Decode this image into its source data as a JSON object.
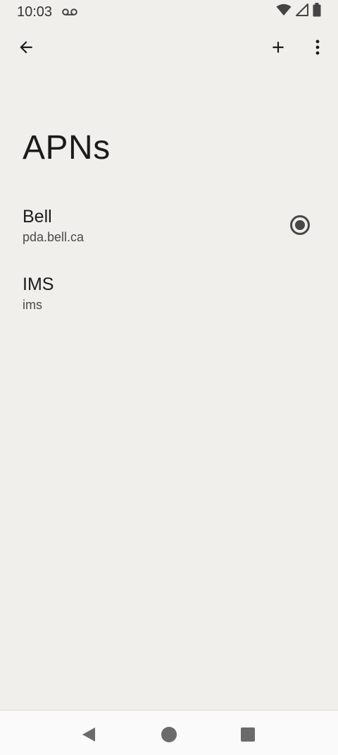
{
  "status_bar": {
    "time": "10:03",
    "icons": [
      "voicemail-icon",
      "wifi-icon",
      "signal-icon",
      "battery-icon"
    ]
  },
  "toolbar": {
    "back_icon": "arrow-back-icon",
    "add_icon": "plus-icon",
    "more_icon": "more-vert-icon"
  },
  "page": {
    "title": "APNs"
  },
  "apns": [
    {
      "name": "Bell",
      "address": "pda.bell.ca",
      "selected": true
    },
    {
      "name": "IMS",
      "address": "ims",
      "selected": false
    }
  ],
  "nav_bar": {
    "icons": [
      "nav-back-icon",
      "nav-home-icon",
      "nav-recents-icon"
    ]
  },
  "colors": {
    "background": "#f0efeb",
    "text_primary": "#1b1b1b",
    "text_secondary": "#4a4a4a",
    "radio": "#474747",
    "nav_bar": "#fafafa"
  }
}
